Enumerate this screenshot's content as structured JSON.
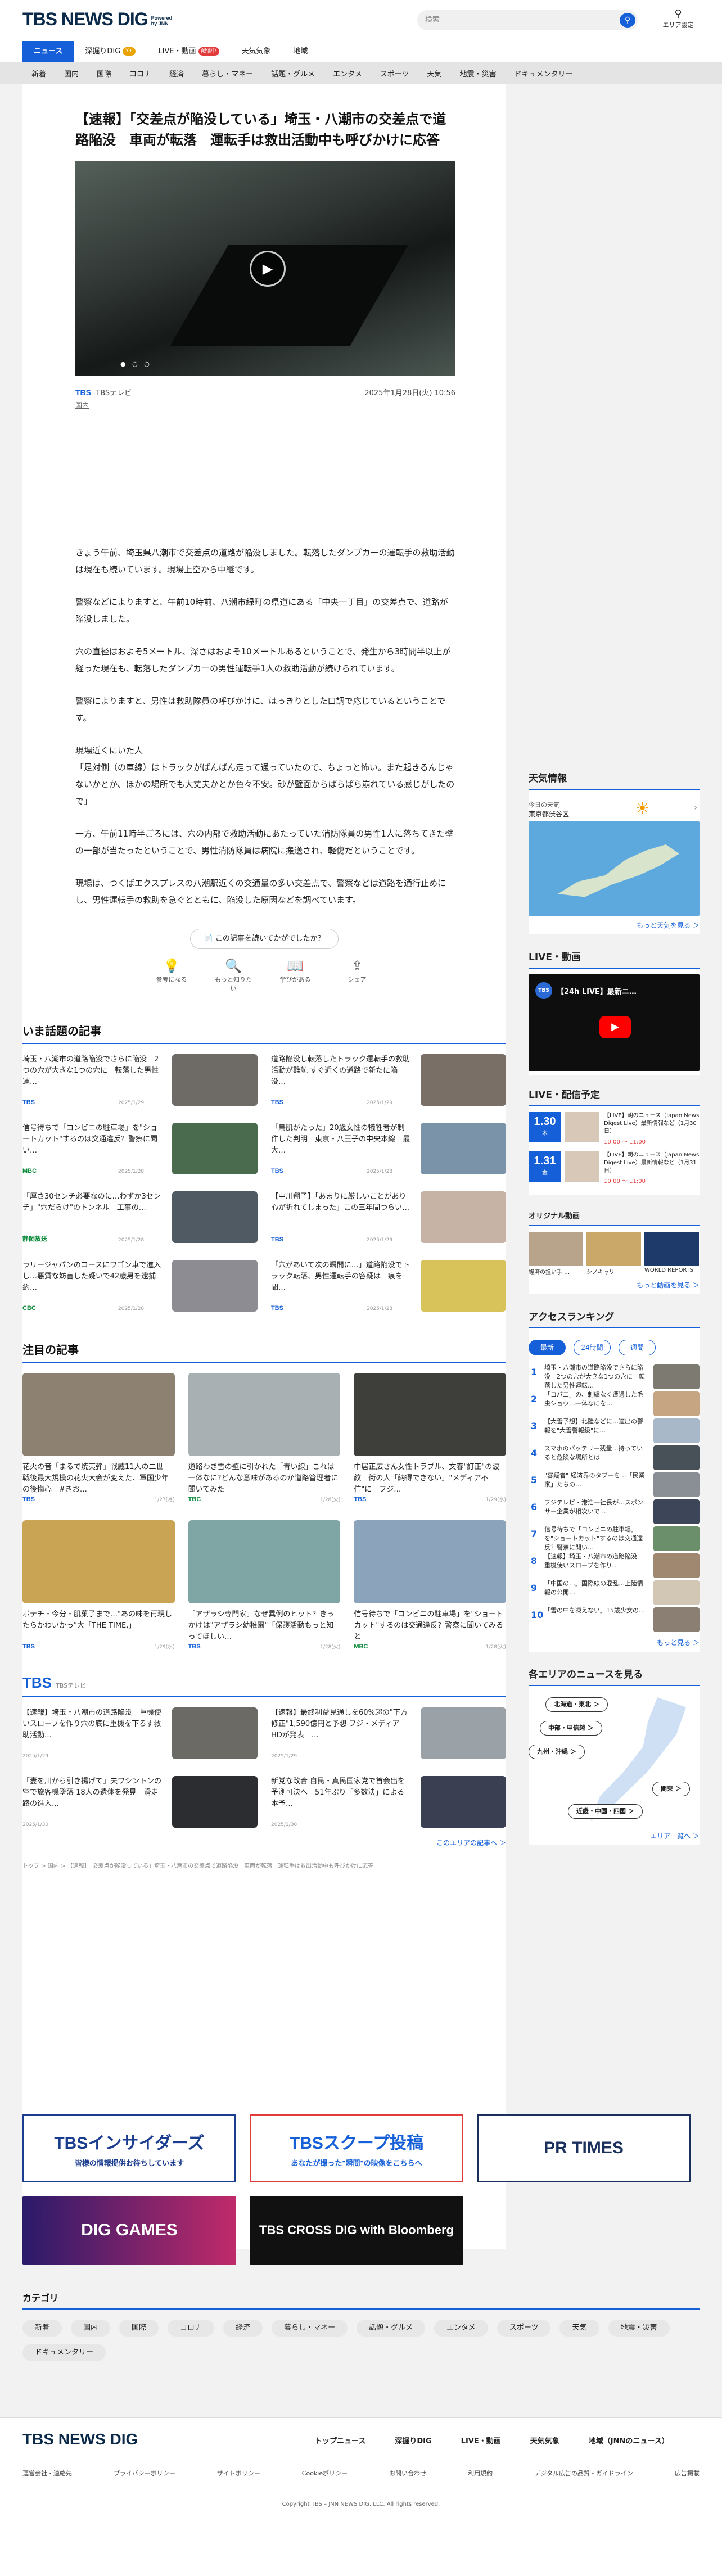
{
  "header": {
    "logo": "TBS NEWS DIG",
    "powered": "Powered by JNN",
    "search_placeholder": "検索",
    "area_label": "エリア設定"
  },
  "main_nav": [
    {
      "label": "ニュース",
      "active": true,
      "badge": ""
    },
    {
      "label": "深掘りDIG",
      "active": false,
      "badge": "Y+"
    },
    {
      "label": "LIVE・動画",
      "active": false,
      "badge": "配信中"
    },
    {
      "label": "天気気象",
      "active": false,
      "badge": ""
    },
    {
      "label": "地域",
      "active": false,
      "badge": ""
    }
  ],
  "cat_nav": [
    "新着",
    "国内",
    "国際",
    "コロナ",
    "経済",
    "暮らし・マネー",
    "話題・グルメ",
    "エンタメ",
    "スポーツ",
    "天気",
    "地震・災害",
    "ドキュメンタリー"
  ],
  "article": {
    "headline": "【速報】「交差点が陥没している」埼玉・八潮市の交差点で道路陥没　車両が転落　運転手は救出活動中も呼びかけに応答",
    "source": "TBSテレビ",
    "date": "2025年1月28日(火) 10:56",
    "category": "国内",
    "paragraphs": [
      "きょう午前、埼玉県八潮市で交差点の道路が陥没しました。転落したダンプカーの運転手の救助活動は現在も続いています。現場上空から中継です。",
      "警察などによりますと、午前10時前、八潮市緑町の県道にある「中央一丁目」の交差点で、道路が陥没しました。",
      "穴の直径はおよそ5メートル、深さはおよそ10メートルあるということで、発生から3時間半以上が経った現在も、転落したダンプカーの男性運転手1人の救助活動が続けられています。",
      "警察によりますと、男性は救助隊員の呼びかけに、はっきりとした口調で応じているということです。",
      "現場近くにいた人\n「足対側（の車線）はトラックがばんばん走って通っていたので、ちょっと怖い。また起きるんじゃないかとか、ほかの場所でも大丈夫かとか色々不安。砂が壁面からぱらぱら崩れている感じがしたので」",
      "一方、午前11時半ごろには、穴の内部で救助活動にあたっていた消防隊員の男性1人に落ちてきた壁の一部が当たったということで、男性消防隊員は病院に搬送され、軽傷だということです。",
      "現場は、つくばエクスプレスの八潮駅近くの交通量の多い交差点で、警察などは道路を通行止めにし、男性運転手の救助を急ぐとともに、陥没した原因などを調べています。"
    ],
    "feedback_question": "この記事を読いてかがでしたか？",
    "feedback_options": [
      "参考になる",
      "もっと知りたい",
      "学びがある",
      "シェア"
    ]
  },
  "trending": {
    "title": "いま話題の記事",
    "items": [
      {
        "title": "埼玉・八潮市の道路陥没でさらに陥没　2つの穴が大きな1つの穴に　転落した男性運…",
        "source": "TBS",
        "date": "2025/1/29",
        "color": "#1560d8"
      },
      {
        "title": "道路陥没し転落したトラック運転手の救助活動が難航 すぐ近くの道路で新たに陥没…",
        "source": "TBS",
        "date": "2025/1/29",
        "color": "#1560d8"
      },
      {
        "title": "信号待ちで「コンビニの駐車場」を\"ショートカット\"するのは交通違反？警察に聞い…",
        "source": "MBC",
        "date": "2025/1/28",
        "color": "#0a8a3a"
      },
      {
        "title": "「鳥肌がたった」20歳女性の犠牲者が制作した判明　東京・八王子の中央本線　最大…",
        "source": "TBS",
        "date": "2025/1/28",
        "color": "#1560d8"
      },
      {
        "title": "「厚さ30センチ必要なのに…わずか3センチ」\"穴だらけ\"のトンネル　工事の…",
        "source": "静岡放送",
        "date": "2025/1/28",
        "color": "#0a8a3a"
      },
      {
        "title": "【中川翔子】「あまりに厳しいことがあり心が折れてしまった」この三年間つらい…",
        "source": "TBS",
        "date": "2025/1/29",
        "color": "#1560d8"
      },
      {
        "title": "ラリージャパンのコースにワゴン車で進入し…悪質な妨害した疑いで42歳男を逮捕 約…",
        "source": "CBC",
        "date": "2025/1/28",
        "color": "#0a8a3a"
      },
      {
        "title": "「穴があいて次の瞬間に…」道路陥没でトラック転落、男性運転手の容疑は　痕を聞…",
        "source": "TBS",
        "date": "2025/1/28",
        "color": "#1560d8"
      }
    ],
    "thumbs": [
      "#6e6a66",
      "#7a6f66",
      "#4b6b4e",
      "#7b93a8",
      "#505a62",
      "#c7b3a6",
      "#8c8c92",
      "#d8c25a"
    ]
  },
  "featured": {
    "title": "注目の記事",
    "items": [
      {
        "title": "花火の音「まるで焼夷弾」戦威11人の二世　戦後最大規模の花火大会が変えた、軍国少年の後悔心　#きお…",
        "source": "TBS",
        "date": "1/27(月)"
      },
      {
        "title": "道路わき雪の壁に引かれた「青い線」これは一体なに?どんな意味があるのか道路管理者に聞いてみた",
        "source": "TBC",
        "date": "1/28(火)"
      },
      {
        "title": "中居正広さん女性トラブル、文春\"訂正\"の波紋　街の人「納得できない」\"メディア不信\"に　フジ…",
        "source": "TBS",
        "date": "1/29(水)"
      },
      {
        "title": "ポテチ・今分・肌菓子まで…\"あの味を再現したらかわいかっ\"大「THE TIME,」",
        "source": "TBS",
        "date": "1/29(水)"
      },
      {
        "title": "「アザラシ専門家」なぜ異例のヒット？きっかけは\"アザラシ幼稚園\"「保護活動もっと知ってほしい…",
        "source": "TBS",
        "date": "1/28(火)"
      },
      {
        "title": "信号待ちで「コンビニの駐車場」を\"ショートカット\"するのは交通違反？警察に聞いてみると",
        "source": "MBC",
        "date": "1/28(火)"
      }
    ],
    "thumbs": [
      "#8d8272",
      "#a9b0b4",
      "#3e3e3a",
      "#c9a455",
      "#7fa6a4",
      "#8ba3bb"
    ]
  },
  "tbs_section": {
    "title": "TBS",
    "subtitle": "TBSテレビ",
    "items": [
      {
        "title": "【速報】埼玉・八潮市の道路陥没　重機使いスロープを作り穴の底に重機を下ろす救助活動…",
        "date": "2025/1/29"
      },
      {
        "title": "【速報】最終利益見通しを60%超の\"下方修正\"1,590億円と予想 フジ・メディアHDが発表　…",
        "date": "2025/1/29"
      },
      {
        "title": "「妻を川から引き揚げて」夫ワシントンの空で旅客機墜落 18人の遺体を発見　滑走路の進入…",
        "date": "2025/1/30"
      },
      {
        "title": "新党な改合 自民・真民国家党で首会出を予測可決へ　51年ぶり「多数決」による本予…",
        "date": "2025/1/30"
      }
    ],
    "thumbs": [
      "#6b6a64",
      "#9aa2a8",
      "#2c2d31",
      "#3a3f52"
    ],
    "more": "このエリアの記事へ ＞"
  },
  "breadcrumb": "トップ > 国内 > 【速報】「交差点が陥没している」埼玉・八潮市の交差点で道路陥没　車両が転落　運転手は救出活動中も呼びかけに応答",
  "banners": [
    {
      "label": "TBSインサイダーズ",
      "sub": "皆様の情報提供お待ちしています"
    },
    {
      "label": "TBSスクープ投稿",
      "sub": "あなたが撮った\"瞬間\"の映像をこちらへ"
    },
    {
      "label": "PR TIMES",
      "sub": ""
    },
    {
      "label": "DIG GAMES",
      "sub": ""
    },
    {
      "label": "TBS CROSS DIG with Bloomberg",
      "sub": ""
    }
  ],
  "categories": {
    "title": "カテゴリ",
    "tags": [
      "新着",
      "国内",
      "国際",
      "コロナ",
      "経済",
      "暮らし・マネー",
      "話題・グルメ",
      "エンタメ",
      "スポーツ",
      "天気",
      "地震・災害",
      "ドキュメンタリー"
    ]
  },
  "sidebar": {
    "weather": {
      "title": "天気情報",
      "label": "今日の天気",
      "place": "東京都渋谷区",
      "more": "もっと天気を見る ＞"
    },
    "live": {
      "title": "LIVE・動画",
      "video_title": "【24h LIVE】最新ニ…",
      "channel": "TBS"
    },
    "schedule": {
      "title": "LIVE・配信予定",
      "items": [
        {
          "day": "1.30",
          "weekday": "木",
          "title": "【LIVE】朝のニュース（Japan News Digest Live）最新情報など（1月30日）",
          "time": "10:00 〜 11:00"
        },
        {
          "day": "1.31",
          "weekday": "金",
          "title": "【LIVE】朝のニュース（Japan News Digest Live）最新情報など（1月31日）",
          "time": "10:00 〜 11:00"
        }
      ]
    },
    "original": {
      "title": "オリジナル動画",
      "items": [
        "経済の担い手 …",
        "シノキャリ",
        "WORLD REPORTS"
      ],
      "more": "もっと動画を見る ＞"
    },
    "ranking": {
      "title": "アクセスランキング",
      "tabs": [
        "最新",
        "24時間",
        "週間"
      ],
      "items": [
        "埼玉・八潮市の道路陥没でさらに陥没　2つの穴が大きな1つの穴に　転落した男性運転…",
        "「コバエ」の、刺繍なく遭遇した毛虫ショウ…一体なにを…",
        "【大雪予想】北陸などに…適出の警報を\"大雪警報級\"に…",
        "スマホのバッテリー残量…持っていると危険な場所とは",
        "\"容疑者\" 経済界のタブーを…「民業家」たちの…",
        "フジテレビ・港浩一社長が…スポンサー企業が相次いで…",
        "信号待ちで「コンビニの駐車場」を\"ショートカット\"するのは交通違反？警察に聞い…",
        "【速報】埼玉・八潮市の道路陥没　重機使いスロープを作り…",
        "「中国の…」国際線の混乱…上陸情報の公開…",
        "「雪の中を凍えない」15歳少女の…"
      ],
      "thumbs": [
        "#7d7a72",
        "#c6a682",
        "#a8b8c8",
        "#485058",
        "#8a8f96",
        "#3c4658",
        "#6b8f6a",
        "#a08870",
        "#d2c6b4",
        "#8b7e73"
      ],
      "more": "もっと見る ＞"
    },
    "region": {
      "title": "各エリアのニュースを見る",
      "areas": [
        "北海道・東北 ＞",
        "中部・甲信越 ＞",
        "九州・沖縄 ＞",
        "関東 ＞",
        "近畿・中国・四国 ＞"
      ],
      "more": "エリア一覧へ ＞"
    }
  },
  "footer": {
    "logo": "TBS NEWS DIG",
    "links": [
      "トップニュース",
      "深掘りDIG",
      "LIVE・動画",
      "天気気象",
      "地域（JNNのニュース）"
    ],
    "sublinks": [
      "運営会社・連絡先",
      "プライバシーポリシー",
      "サイトポリシー",
      "Cookieポリシー",
      "お問い合わせ",
      "利用規約",
      "デジタル広告の品質・ガイドライン",
      "広告掲載"
    ],
    "copyright": "Copyright TBS – JNN NEWS DIG, LLC. All rights reserved."
  }
}
